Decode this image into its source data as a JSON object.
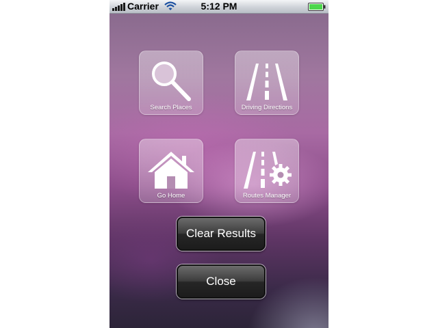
{
  "status_bar": {
    "carrier": "Carrier",
    "time": "5:12 PM",
    "icons": {
      "signal": "signal-bars-icon",
      "wifi": "wifi-icon",
      "battery": "battery-icon"
    },
    "battery_level_percent": 100,
    "battery_color": "#4cd64c"
  },
  "menu": {
    "tiles": [
      {
        "label": "Search Places",
        "icon": "magnifier-icon"
      },
      {
        "label": "Driving Directions",
        "icon": "road-icon"
      },
      {
        "label": "Go Home",
        "icon": "house-icon"
      },
      {
        "label": "Routes Manager",
        "icon": "road-gear-icon"
      }
    ]
  },
  "actions": {
    "clear_label": "Clear Results",
    "close_label": "Close"
  }
}
